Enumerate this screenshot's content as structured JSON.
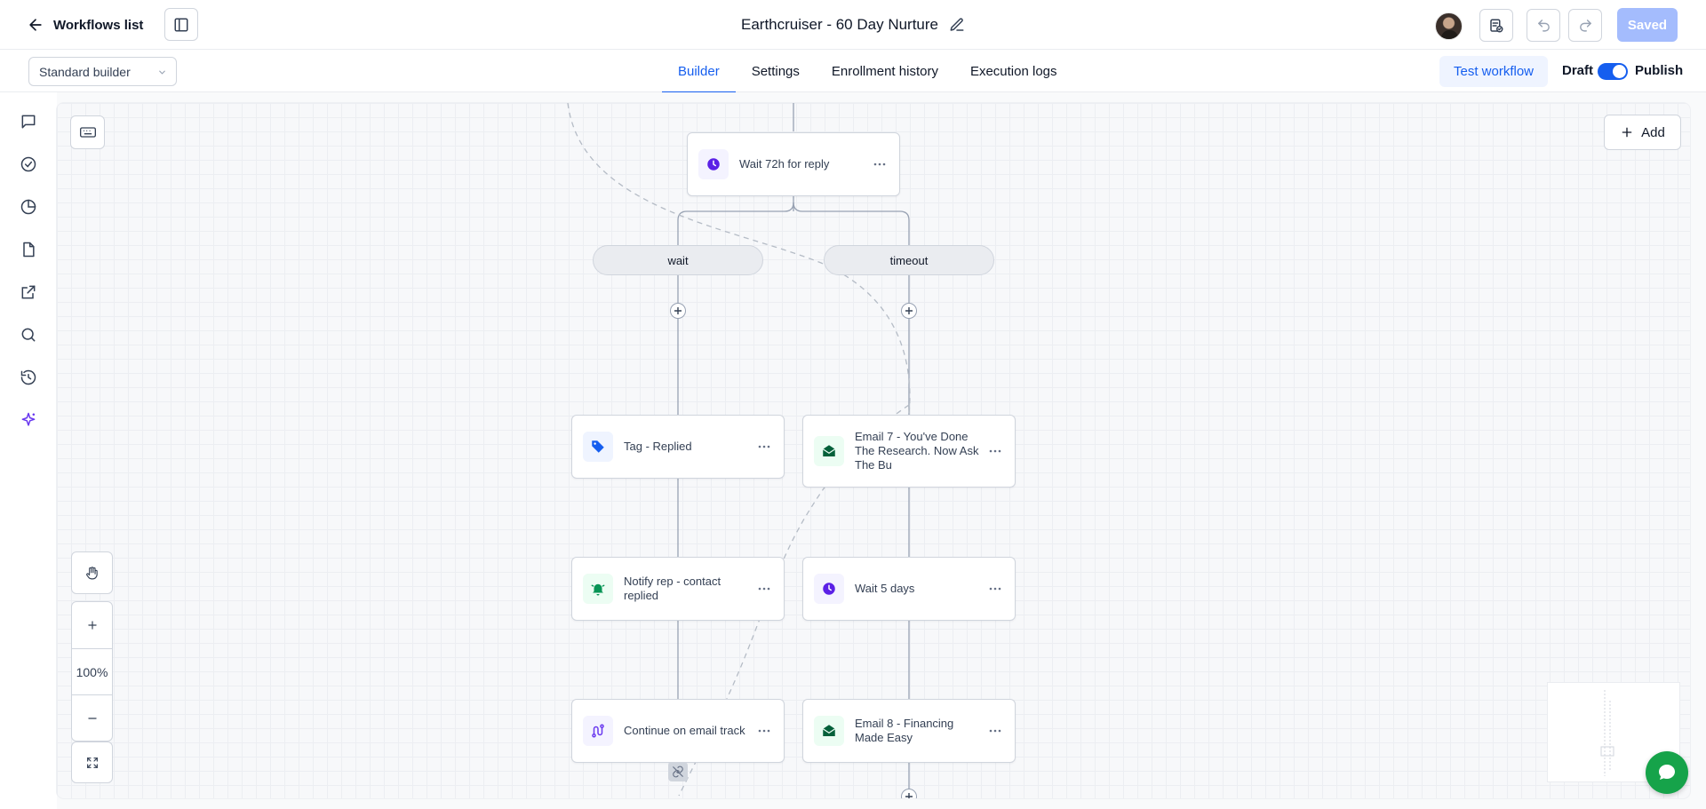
{
  "header": {
    "back_label": "Workflows list",
    "title": "Earthcruiser - 60 Day Nurture",
    "saved_label": "Saved"
  },
  "subbar": {
    "builder_mode": "Standard builder",
    "tabs": [
      {
        "label": "Builder",
        "active": true
      },
      {
        "label": "Settings",
        "active": false
      },
      {
        "label": "Enrollment history",
        "active": false
      },
      {
        "label": "Execution logs",
        "active": false
      }
    ],
    "test_label": "Test workflow",
    "draft_label": "Draft",
    "publish_label": "Publish"
  },
  "rail": {
    "icons": [
      "chat-icon",
      "check-circle-icon",
      "pie-chart-icon",
      "document-icon",
      "external-link-icon",
      "search-icon",
      "history-icon",
      "sparkle-icon"
    ]
  },
  "canvas": {
    "add_label": "Add",
    "zoom": "100%",
    "nodes": {
      "wait72": "Wait 72h for reply",
      "tag_replied": "Tag - Replied",
      "email7": "Email 7 - You've Done The Research. Now Ask The Bu",
      "notify_rep": "Notify rep - contact replied",
      "wait5": "Wait 5 days",
      "continue_email": "Continue on email track",
      "email8": "Email 8 - Financing Made Easy"
    },
    "branches": {
      "wait": "wait",
      "timeout": "timeout"
    }
  },
  "colors": {
    "accent": "#155eef",
    "saved_bg": "#a4bcfd",
    "wait_icon": "#5b21e6",
    "email_icon": "#05603a",
    "chat_bubble": "#16a34a"
  }
}
